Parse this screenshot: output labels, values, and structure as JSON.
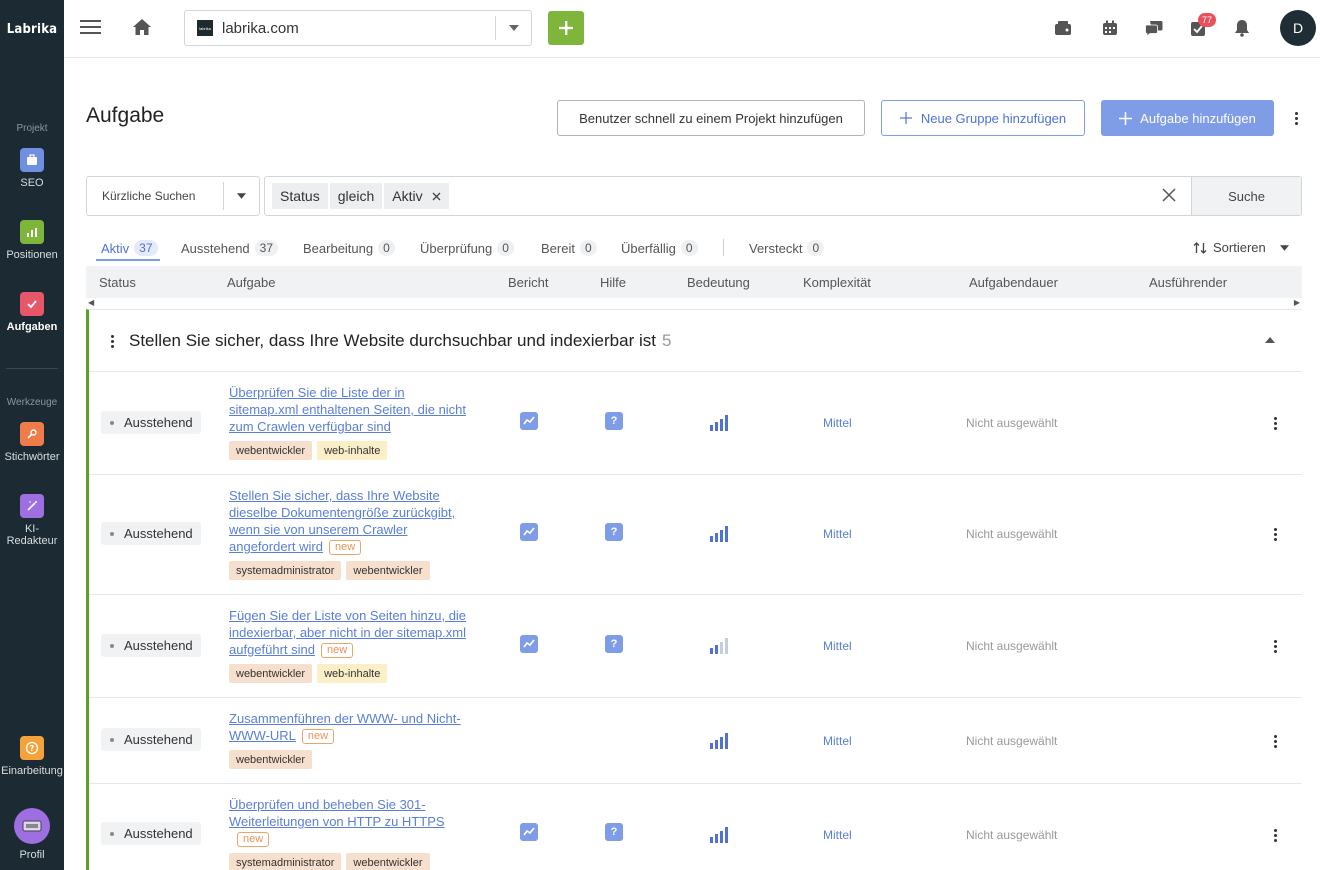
{
  "brand": "Labrika",
  "sidebar": {
    "section_project": "Projekt",
    "section_tools": "Werkzeuge",
    "items": [
      {
        "label": "SEO",
        "color": "#6f8fe0"
      },
      {
        "label": "Positionen",
        "color": "#7db63a"
      },
      {
        "label": "Aufgaben",
        "color": "#e8566a"
      },
      {
        "label": "Stichwörter",
        "color": "#f07c4a"
      },
      {
        "label": "KI-Redakteur",
        "color": "#9d6fe0"
      },
      {
        "label": "Einarbeitung",
        "color": "#f5a23a"
      },
      {
        "label": "Profil",
        "color": "#9d6fe0"
      }
    ]
  },
  "topbar": {
    "site": "labrika.com",
    "site_logo_text": "labrika",
    "notification_count": "77",
    "avatar_letter": "D"
  },
  "header": {
    "title": "Aufgabe",
    "btn_quick_add_user": "Benutzer schnell zu einem Projekt hinzufügen",
    "btn_new_group": "Neue Gruppe hinzufügen",
    "btn_add_task": "Aufgabe hinzufügen"
  },
  "search": {
    "recent_label": "Kürzliche Suchen",
    "chip": [
      "Status",
      "gleich",
      "Aktiv"
    ],
    "button": "Suche"
  },
  "tabs": [
    {
      "label": "Aktiv",
      "count": "37"
    },
    {
      "label": "Ausstehend",
      "count": "37"
    },
    {
      "label": "Bearbeitung",
      "count": "0"
    },
    {
      "label": "Überprüfung",
      "count": "0"
    },
    {
      "label": "Bereit",
      "count": "0"
    },
    {
      "label": "Überfällig",
      "count": "0"
    },
    {
      "label": "Versteckt",
      "count": "0"
    }
  ],
  "sort_label": "Sortieren",
  "columns": [
    "Status",
    "Aufgabe",
    "Bericht",
    "Hilfe",
    "Bedeutung",
    "Komplexität",
    "Aufgabendauer",
    "Ausführender"
  ],
  "group": {
    "title": "Stellen Sie sicher, dass Ihre Website durchsuchbar und indexierbar ist",
    "count": "5"
  },
  "new_label": "new",
  "rows": [
    {
      "status": "Ausstehend",
      "task": "Überprüfen Sie die Liste der in sitemap.xml enthaltenen Seiten, die nicht zum Crawlen verfügbar sind",
      "tags": [
        "webentwickler",
        "web-inhalte"
      ],
      "complexity": "Mittel",
      "duration": "Nicht ausgewählt"
    },
    {
      "status": "Ausstehend",
      "task": "Stellen Sie sicher, dass Ihre Website dieselbe Dokumentengröße zurückgibt, wenn sie von unserem Crawler angefordert wird",
      "tags": [
        "systemadministrator",
        "webentwickler"
      ],
      "complexity": "Mittel",
      "duration": "Nicht ausgewählt"
    },
    {
      "status": "Ausstehend",
      "task": "Fügen Sie der Liste von Seiten hinzu, die indexierbar, aber nicht in der sitemap.xml aufgeführt sind",
      "tags": [
        "webentwickler",
        "web-inhalte"
      ],
      "complexity": "Mittel",
      "duration": "Nicht ausgewählt"
    },
    {
      "status": "Ausstehend",
      "task": "Zusammenführen der WWW- und Nicht-WWW-URL",
      "tags": [
        "webentwickler"
      ],
      "complexity": "Mittel",
      "duration": "Nicht ausgewählt"
    },
    {
      "status": "Ausstehend",
      "task": "Überprüfen und beheben Sie 301-Weiterleitungen von HTTP zu HTTPS",
      "tags": [
        "systemadministrator",
        "webentwickler"
      ],
      "complexity": "Mittel",
      "duration": "Nicht ausgewählt"
    }
  ]
}
